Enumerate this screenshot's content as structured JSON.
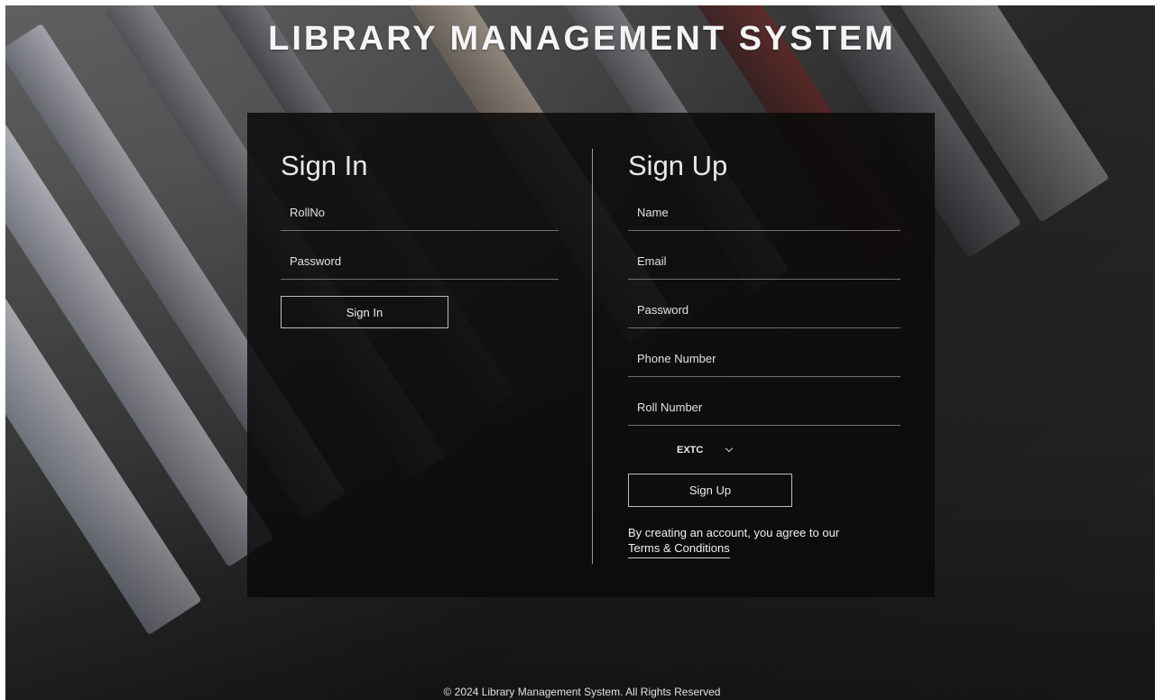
{
  "app": {
    "title": "LIBRARY MANAGEMENT SYSTEM",
    "footer": "© 2024 Library Management System. All Rights Reserved"
  },
  "sign_in": {
    "heading": "Sign In",
    "rollno_placeholder": "RollNo",
    "password_placeholder": "Password",
    "button_label": "Sign In"
  },
  "sign_up": {
    "heading": "Sign Up",
    "name_placeholder": "Name",
    "email_placeholder": "Email",
    "password_placeholder": "Password",
    "phone_placeholder": "Phone Number",
    "roll_placeholder": "Roll Number",
    "department_selected": "EXTC",
    "button_label": "Sign Up",
    "terms_text": "By creating an account, you agree to our",
    "terms_link": "Terms & Conditions"
  }
}
